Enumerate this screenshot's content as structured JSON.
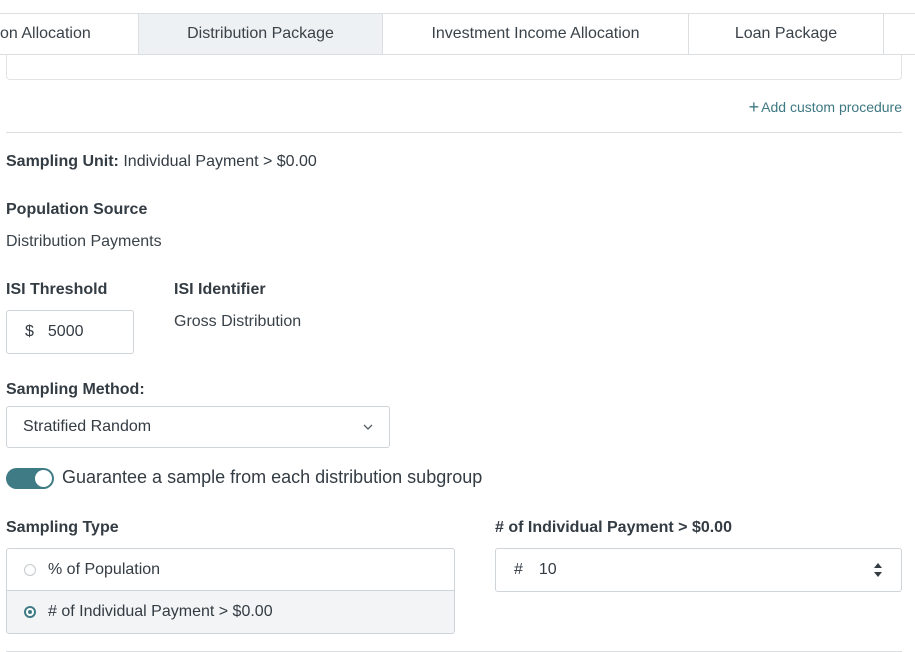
{
  "tabs": [
    {
      "label": "on Allocation"
    },
    {
      "label": "Distribution Package",
      "active": true
    },
    {
      "label": "Investment Income Allocation"
    },
    {
      "label": "Loan Package"
    },
    {
      "label": ""
    }
  ],
  "add_custom_procedure": "Add custom procedure",
  "sampling_unit": {
    "label": "Sampling Unit:",
    "value": "Individual Payment > $0.00"
  },
  "population_source": {
    "label": "Population Source",
    "value": "Distribution Payments"
  },
  "isi_threshold": {
    "label": "ISI Threshold",
    "prefix": "$",
    "value": "5000"
  },
  "isi_identifier": {
    "label": "ISI Identifier",
    "value": "Gross Distribution"
  },
  "sampling_method": {
    "label": "Sampling Method:",
    "selected": "Stratified Random"
  },
  "guarantee_toggle": {
    "label": "Guarantee a sample from each distribution subgroup",
    "on": true
  },
  "sampling_type": {
    "label": "Sampling Type",
    "options": [
      {
        "label": "% of Population",
        "checked": false
      },
      {
        "label": "# of Individual Payment > $0.00",
        "checked": true
      }
    ]
  },
  "count_field": {
    "label": "# of Individual Payment > $0.00",
    "prefix": "#",
    "value": "10"
  },
  "colors": {
    "accent": "#3f7b85",
    "tab_active_bg": "#eef1f3",
    "border": "#dcdfe2"
  }
}
